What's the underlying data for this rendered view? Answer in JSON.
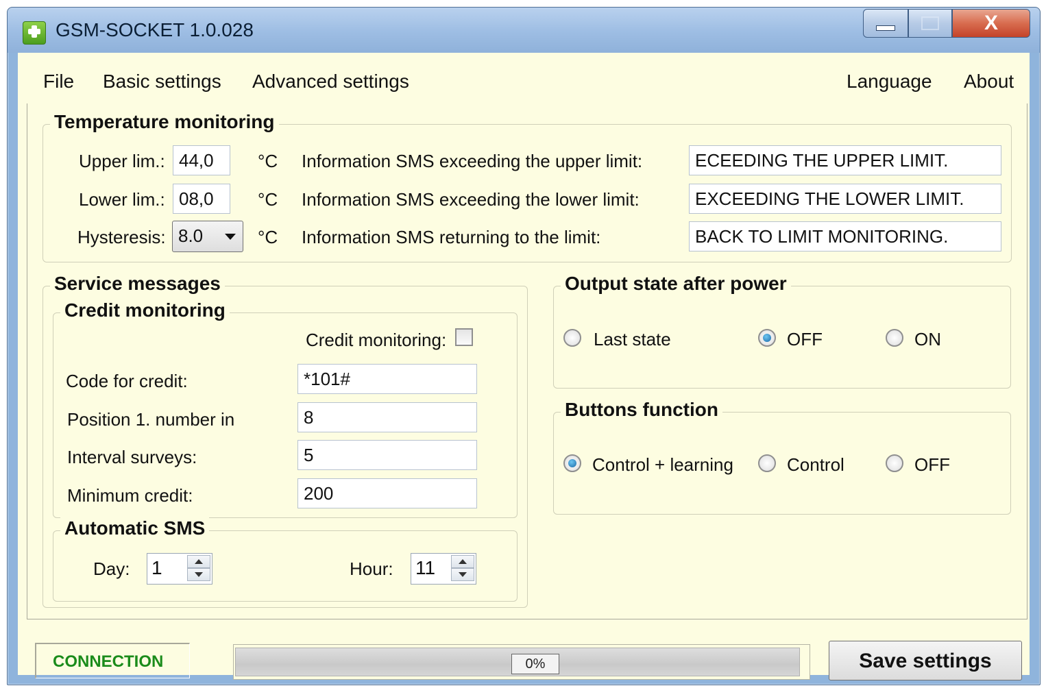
{
  "window": {
    "title": "GSM-SOCKET 1.0.028",
    "close_glyph": "X"
  },
  "menu": {
    "left": [
      "File",
      "Basic settings",
      "Advanced settings"
    ],
    "right": [
      "Language",
      "About"
    ]
  },
  "temperature": {
    "title": "Temperature monitoring",
    "upper_label": "Upper lim.:",
    "upper_value": "44,0",
    "lower_label": "Lower lim.:",
    "lower_value": "08,0",
    "hysteresis_label": "Hysteresis:",
    "hysteresis_value": "8.0",
    "unit": "°C",
    "sms_upper_label": "Information SMS exceeding the upper limit:",
    "sms_upper_value": "ECEEDING THE UPPER LIMIT.",
    "sms_lower_label": "Information SMS exceeding the lower limit:",
    "sms_lower_value": "EXCEEDING THE LOWER LIMIT.",
    "sms_return_label": "Information SMS returning to the limit:",
    "sms_return_value": "BACK TO LIMIT MONITORING."
  },
  "service": {
    "title": "Service messages",
    "credit": {
      "title": "Credit monitoring",
      "checkbox_label": "Credit monitoring:",
      "checked": false,
      "code_label": "Code for credit:",
      "code_value": "*101#",
      "position_label": "Position 1. number in",
      "position_value": "8",
      "interval_label": "Interval surveys:",
      "interval_value": "5",
      "min_label": "Minimum credit:",
      "min_value": "200"
    },
    "auto_sms": {
      "title": "Automatic SMS",
      "day_label": "Day:",
      "day_value": "1",
      "hour_label": "Hour:",
      "hour_value": "11"
    }
  },
  "output_state": {
    "title": "Output state after power",
    "options": [
      "Last state",
      "OFF",
      "ON"
    ],
    "selected": "OFF"
  },
  "buttons_function": {
    "title": "Buttons function",
    "options": [
      "Control + learning",
      "Control",
      "OFF"
    ],
    "selected": "Control + learning"
  },
  "status": {
    "connection": "CONNECTION",
    "progress_text": "0%",
    "progress": 0,
    "save_label": "Save settings"
  },
  "colors": {
    "background": "#fdfde1",
    "connection_text": "#1b8c1b"
  }
}
